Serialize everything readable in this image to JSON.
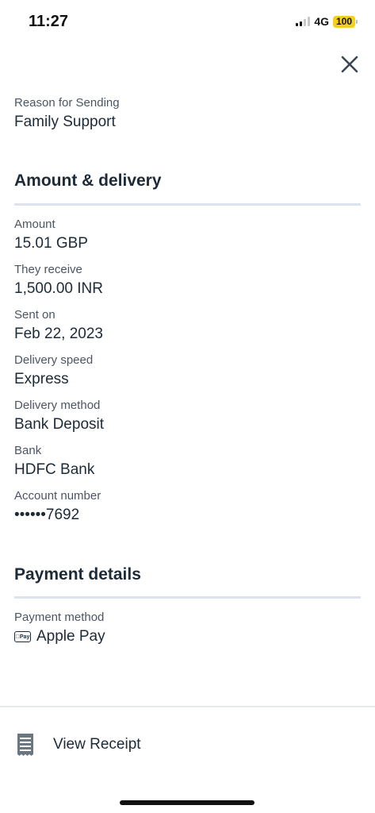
{
  "status_bar": {
    "time": "11:27",
    "network": "4G",
    "battery": "100",
    "signal_bars_active": 2
  },
  "header": {
    "close_icon": "close-icon"
  },
  "reason": {
    "label": "Reason for Sending",
    "value": "Family Support"
  },
  "amount_delivery": {
    "title": "Amount & delivery",
    "fields": [
      {
        "label": "Amount",
        "value": "15.01 GBP"
      },
      {
        "label": "They receive",
        "value": "1,500.00 INR"
      },
      {
        "label": "Sent on",
        "value": "Feb 22, 2023"
      },
      {
        "label": "Delivery speed",
        "value": "Express"
      },
      {
        "label": "Delivery method",
        "value": "Bank Deposit"
      },
      {
        "label": "Bank",
        "value": "HDFC Bank"
      },
      {
        "label": "Account number",
        "value": "••••••7692"
      }
    ]
  },
  "payment_details": {
    "title": "Payment details",
    "method_label": "Payment method",
    "method_value": "Apple Pay",
    "method_badge": "Pay",
    "method_icon": "apple-pay-icon"
  },
  "footer": {
    "view_receipt_label": "View Receipt",
    "receipt_icon": "receipt-icon"
  },
  "colors": {
    "text_primary": "#1d2a37",
    "text_secondary": "#4b5563",
    "divider": "#dde3ea",
    "battery": "#f5cf1f"
  }
}
